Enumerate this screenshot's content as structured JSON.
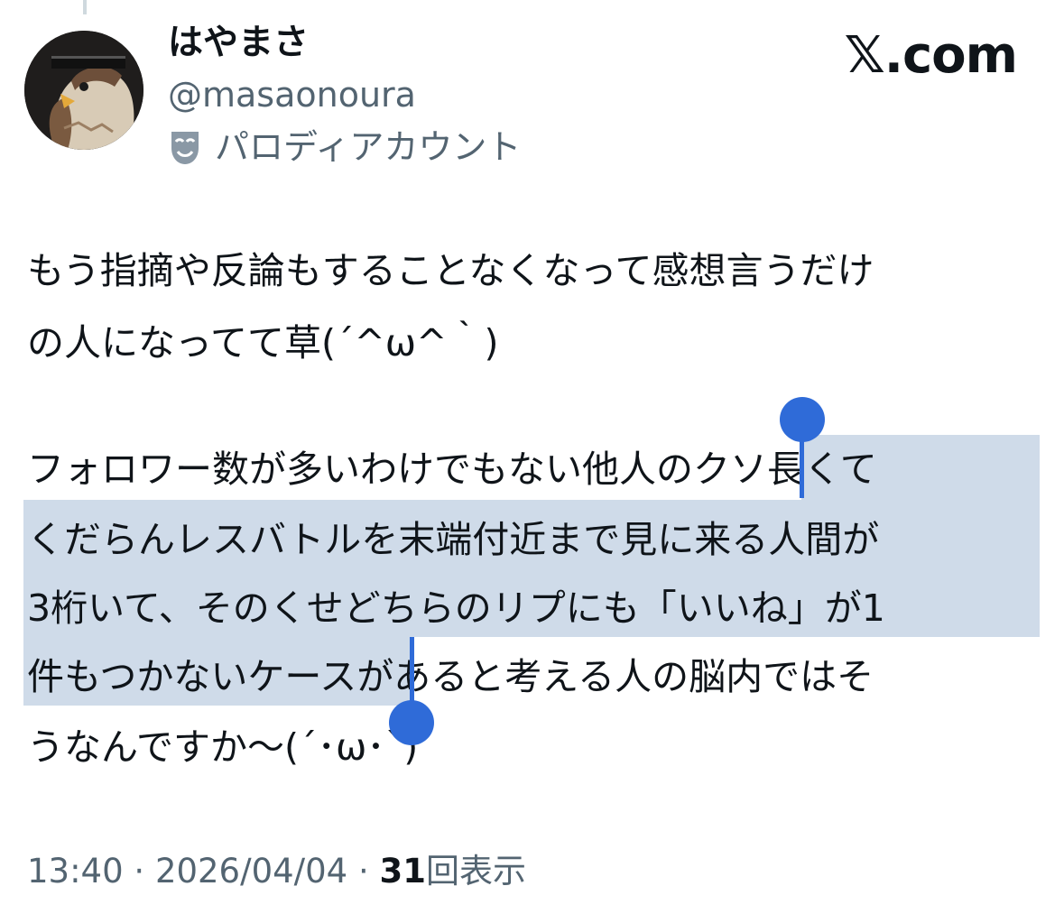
{
  "author": {
    "display_name": "はやまさ",
    "handle": "@masaonoura",
    "parody_label": "パロディアカウント",
    "avatar_icon": "falcon-avatar-icon",
    "parody_icon": "theater-mask-icon"
  },
  "site": {
    "logo": "𝕏.com"
  },
  "tweet": {
    "lines": [
      "もう指摘や反論もすることなくなって感想言うだけ",
      "の人になってて草(´^ω^｀)",
      "",
      "フォロワー数が多いわけでもない他人のクソ長くて",
      "くだらんレスバトルを末端付近まで見に来る人間が",
      "3桁いて、そのくせどちらのリプにも「いいね」が1",
      "件もつかないケースがあると考える人の脳内ではそ",
      "うなんですか〜(´･ω･`)"
    ],
    "selected_text": "クソ長くてくだらんレスバトルを末端付近まで見に来る人間が3桁いて、そのくせどちらのリプにも「いいね」が1件もつかないケース"
  },
  "meta": {
    "time": "13:40",
    "separator": "·",
    "date": "2026/04/04",
    "views_count": "31",
    "views_label": "回表示"
  },
  "colors": {
    "selection_highlight": "#cfdbe9",
    "selection_handle": "#2f6bd8",
    "secondary_text": "#536471",
    "primary_text": "#0f1419"
  }
}
